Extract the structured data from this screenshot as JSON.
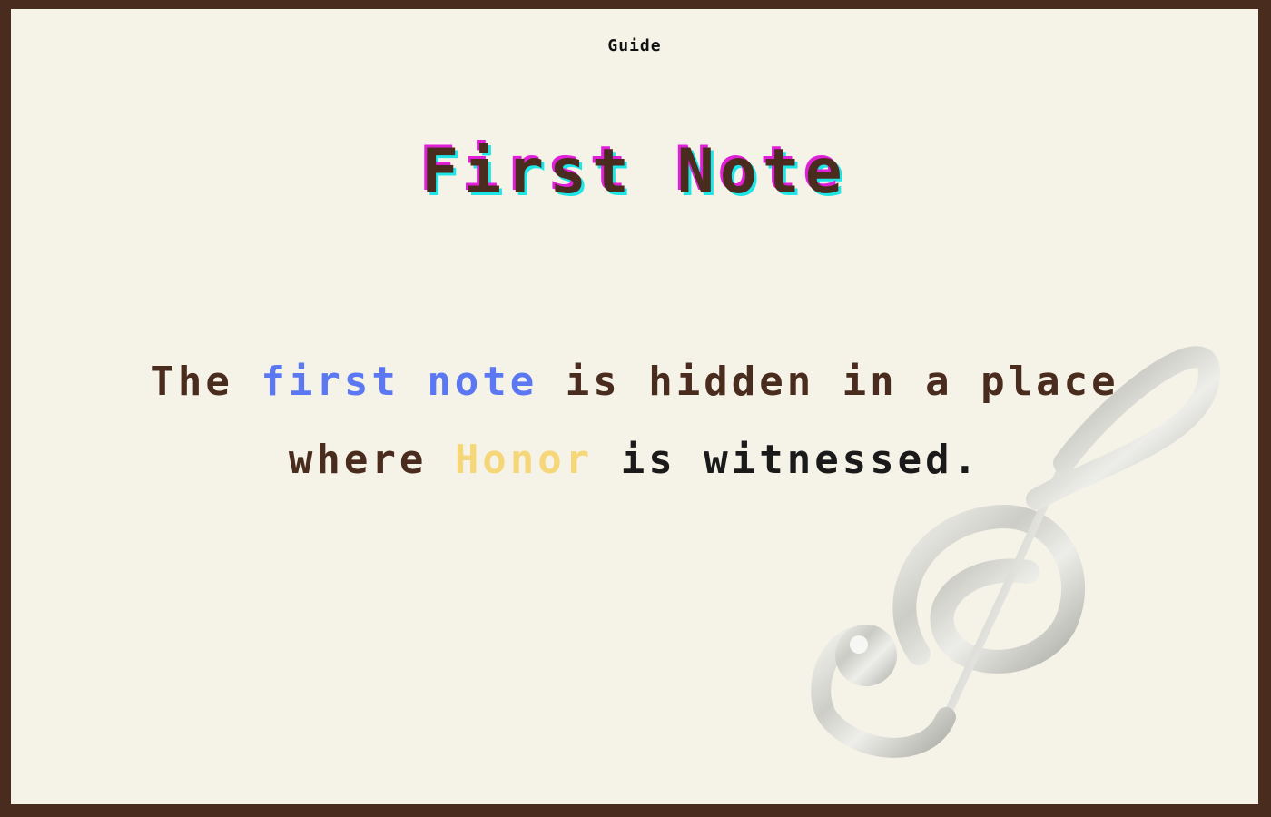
{
  "header": {
    "label": "Guide"
  },
  "page": {
    "title": "First Note"
  },
  "message": {
    "line1": {
      "part1": "The ",
      "highlight": "first note",
      "part2": " is hidden in a place"
    },
    "line2": {
      "part1": "where ",
      "highlight": "Honor",
      "part2": " is witnessed."
    }
  },
  "colors": {
    "background": "#f5f3e7",
    "frame": "#4a2c1e",
    "text": "#4a2c1e",
    "highlight_note": "#5b78f2",
    "highlight_honor": "#f5d77a",
    "title_shadow_magenta": "#e020d8",
    "title_shadow_cyan": "#1ee6e6"
  },
  "icons": {
    "decoration": "treble-clef-icon"
  }
}
